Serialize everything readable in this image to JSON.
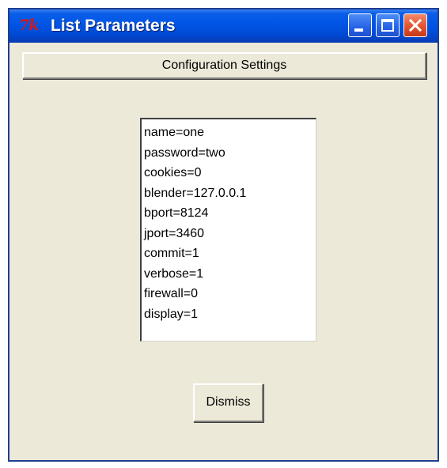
{
  "window": {
    "title": "List Parameters",
    "icon_text": "7k",
    "controls": {
      "minimize_icon": "minimize-icon",
      "maximize_icon": "maximize-icon",
      "close_icon": "close-icon"
    },
    "colors": {
      "titlebar": "#0055e5",
      "close_button": "#e3542f",
      "body": "#ece9d8"
    }
  },
  "header": {
    "label": "Configuration Settings"
  },
  "parameters": [
    "name=one",
    "password=two",
    "cookies=0",
    "blender=127.0.0.1",
    "bport=8124",
    "jport=3460",
    "commit=1",
    "verbose=1",
    "firewall=0",
    "display=1"
  ],
  "buttons": {
    "dismiss_label": "Dismiss"
  }
}
